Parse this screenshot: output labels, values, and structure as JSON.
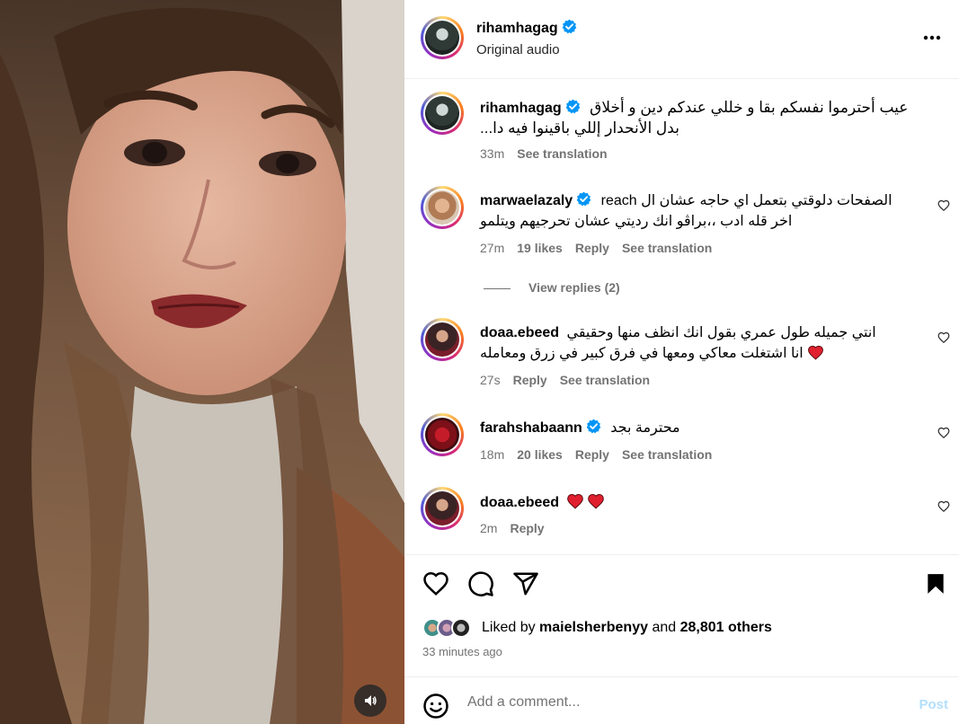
{
  "header": {
    "username": "rihamhagag",
    "subtitle": "Original audio"
  },
  "caption": {
    "username": "rihamhagag",
    "line1": "عيب أحترموا نفسكم بقا و خللي عندكم دين و أخلاق",
    "line2": "بدل الأنحدار إللي باقينوا فيه دا...",
    "time": "33m",
    "see_translation": "See translation"
  },
  "comments": [
    {
      "username": "marwaelazaly",
      "line1": "الصفحات دلوقتي بتعمل اي حاجه عشان ال reach",
      "line2": "اخر قله ادب ،،براڤو انك رديتي عشان تحرجيهم ويتلمو",
      "time": "27m",
      "likes": "19 likes",
      "reply": "Reply",
      "see_translation": "See translation"
    },
    {
      "username": "doaa.ebeed",
      "line1": "انتي جميله طول عمري بقول انك انظف منها وحقيقي",
      "line2": "انا اشتغلت معاكي ومعها في فرق كبير في زرق ومعامله",
      "time": "27s",
      "reply": "Reply",
      "see_translation": "See translation"
    },
    {
      "username": "farahshabaann",
      "line1": "محترمة بجد",
      "time": "18m",
      "likes": "20 likes",
      "reply": "Reply",
      "see_translation": "See translation"
    },
    {
      "username": "doaa.ebeed",
      "time": "2m",
      "reply": "Reply"
    }
  ],
  "view_replies": "View replies (2)",
  "likes": {
    "prefix": "Liked by",
    "user": "maielsherbenyy",
    "and": "and",
    "others": "28,801 others"
  },
  "time_ago": "33 minutes ago",
  "comment_box": {
    "placeholder": "Add a comment...",
    "post_label": "Post"
  },
  "colors": {
    "verified": "#0095f6",
    "heart_red": "#ed4956",
    "muted": "#737373",
    "post_disabled": "#b2dffc"
  },
  "icons": [
    "volume-icon",
    "verified-icon",
    "more-icon",
    "heart-icon",
    "comment-icon",
    "share-icon",
    "bookmark-icon",
    "emoji-icon"
  ]
}
